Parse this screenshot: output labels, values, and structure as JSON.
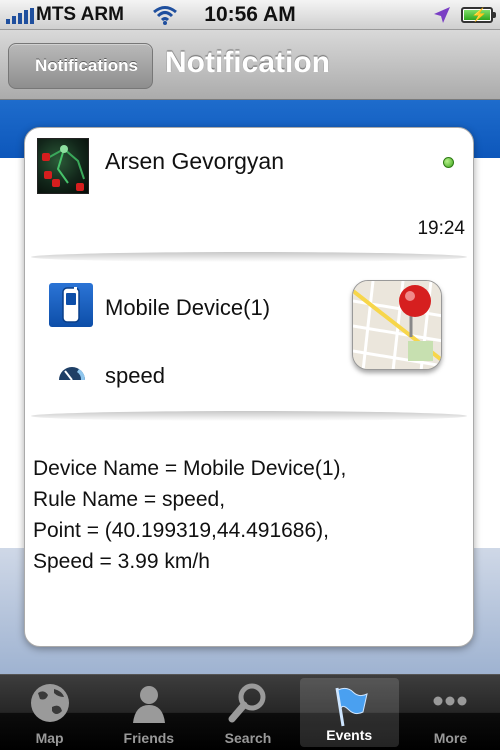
{
  "status_bar": {
    "carrier": "MTS ARM",
    "time": "10:56 AM"
  },
  "nav": {
    "back_label": "Notifications",
    "title": "Notification"
  },
  "notification": {
    "user_name": "Arsen Gevorgyan",
    "time": "19:24",
    "online_status_color": "#3fa61d",
    "device": "Mobile Device(1)",
    "rule": "speed",
    "details": [
      "Device Name = Mobile Device(1),",
      "Rule Name = speed,",
      "Point = (40.199319,44.491686),",
      "Speed = 3.99 km/h"
    ]
  },
  "tabs": [
    {
      "label": "Map",
      "icon": "globe-icon",
      "active": false
    },
    {
      "label": "Friends",
      "icon": "person-icon",
      "active": false
    },
    {
      "label": "Search",
      "icon": "magnifier-icon",
      "active": false
    },
    {
      "label": "Events",
      "icon": "flag-icon",
      "active": true
    },
    {
      "label": "More",
      "icon": "more-dots-icon",
      "active": false
    }
  ],
  "colors": {
    "accent_blue": "#1565c8",
    "active_tab_label": "#ffffff",
    "inactive_tab_label": "#999999"
  }
}
